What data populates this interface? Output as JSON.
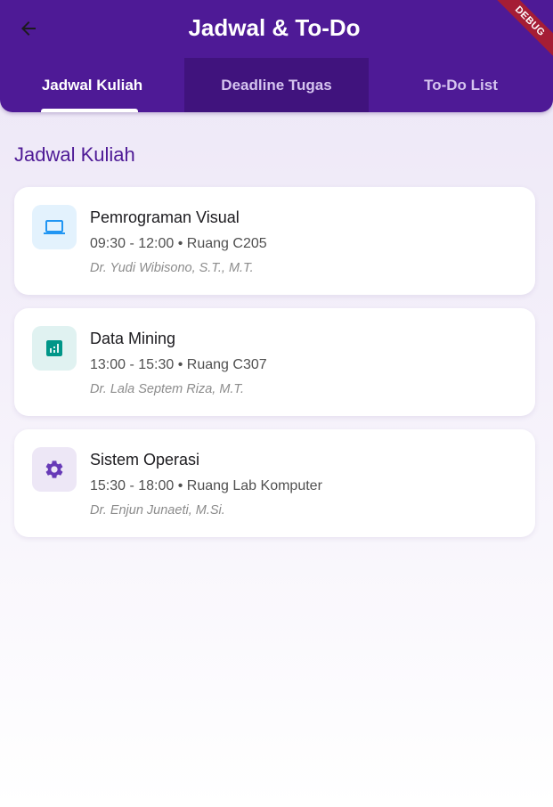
{
  "appbar": {
    "title": "Jadwal & To-Do",
    "back_icon": "arrow-left-icon",
    "color": "#4e1a96",
    "debug_label": "DEBUG"
  },
  "tabs": [
    {
      "label": "Jadwal Kuliah",
      "active": true
    },
    {
      "label": "Deadline Tugas",
      "active": false
    },
    {
      "label": "To-Do List",
      "active": false
    }
  ],
  "section": {
    "title": "Jadwal Kuliah"
  },
  "courses": [
    {
      "name": "Pemrograman Visual",
      "time": "09:30 - 12:00 • Ruang C205",
      "lecturer": "Dr. Yudi Wibisono, S.T., M.T.",
      "icon": "laptop-icon",
      "icon_color": "#2196f3",
      "icon_bg": "#e3f2fd"
    },
    {
      "name": "Data Mining",
      "time": "13:00 - 15:30 • Ruang C307",
      "lecturer": "Dr. Lala Septem Riza, M.T.",
      "icon": "analytics-icon",
      "icon_color": "#009688",
      "icon_bg": "#e0f2f1"
    },
    {
      "name": "Sistem Operasi",
      "time": "15:30 - 18:00 • Ruang Lab Komputer",
      "lecturer": "Dr. Enjun Junaeti, M.Si.",
      "icon": "settings-icon",
      "icon_color": "#673ab7",
      "icon_bg": "#ede7f6"
    }
  ]
}
